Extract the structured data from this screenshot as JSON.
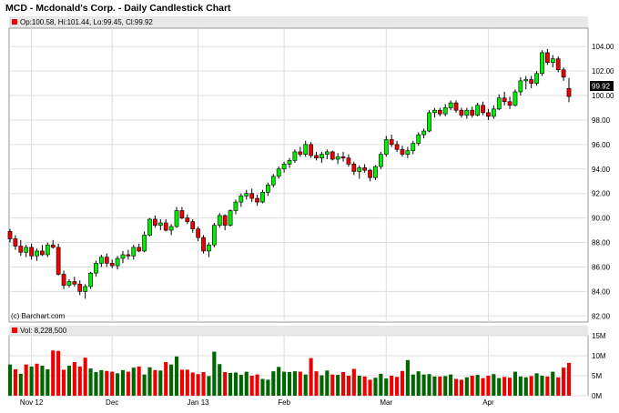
{
  "title": "MCD - Mcdonald's Corp. - Daily Candlestick Chart",
  "info": "Op:100.58, Hi:101.44, Lo:99.45, Cl:99.92",
  "volume_label": "Vol: 8,228,500",
  "copyright": "(c) Barchart.com",
  "colors": {
    "up": "#00ee00",
    "down": "#ee0000",
    "vol_up": "#006600",
    "vol_down": "#ee0000",
    "grid": "#dddddd"
  },
  "chart_data": [
    {
      "type": "candlestick",
      "y_ticks": [
        "104.00",
        "102.00",
        "100.00",
        "98.00",
        "96.00",
        "94.00",
        "92.00",
        "90.00",
        "88.00",
        "86.00",
        "84.00",
        "82.00"
      ],
      "ylim": [
        81.5,
        105.5
      ],
      "last_price_label": "99.92",
      "x_ticks": [
        "Nov 12",
        "Dec",
        "Jan 13",
        "Feb",
        "Mar",
        "Apr"
      ],
      "series": [
        [
          88.9,
          89.1,
          88.0,
          88.3
        ],
        [
          88.3,
          88.6,
          87.4,
          87.7
        ],
        [
          87.7,
          88.2,
          86.9,
          87.2
        ],
        [
          87.2,
          87.8,
          86.8,
          87.6
        ],
        [
          87.6,
          87.9,
          86.6,
          86.9
        ],
        [
          86.9,
          87.5,
          86.5,
          87.3
        ],
        [
          87.3,
          87.8,
          86.9,
          87.0
        ],
        [
          87.0,
          88.0,
          86.8,
          87.8
        ],
        [
          87.8,
          88.2,
          87.5,
          87.6
        ],
        [
          87.6,
          87.9,
          85.3,
          85.4
        ],
        [
          85.4,
          85.7,
          84.2,
          84.5
        ],
        [
          84.5,
          85.0,
          84.3,
          84.8
        ],
        [
          84.8,
          85.2,
          84.4,
          84.6
        ],
        [
          84.6,
          84.9,
          83.7,
          84.0
        ],
        [
          84.0,
          84.6,
          83.4,
          84.4
        ],
        [
          84.4,
          85.6,
          84.2,
          85.5
        ],
        [
          85.5,
          86.5,
          85.2,
          86.3
        ],
        [
          86.3,
          87.0,
          86.0,
          86.8
        ],
        [
          86.8,
          87.1,
          86.0,
          86.3
        ],
        [
          86.3,
          86.6,
          85.9,
          86.1
        ],
        [
          86.1,
          86.9,
          85.8,
          86.7
        ],
        [
          86.7,
          87.3,
          86.3,
          87.0
        ],
        [
          87.0,
          87.4,
          86.6,
          86.9
        ],
        [
          86.9,
          87.8,
          86.6,
          87.6
        ],
        [
          87.6,
          87.9,
          87.2,
          87.3
        ],
        [
          87.3,
          88.9,
          87.2,
          88.6
        ],
        [
          88.6,
          90.0,
          88.5,
          89.9
        ],
        [
          89.9,
          90.2,
          89.2,
          89.4
        ],
        [
          89.4,
          89.9,
          89.0,
          89.6
        ],
        [
          89.6,
          89.9,
          88.9,
          89.0
        ],
        [
          89.0,
          89.5,
          88.6,
          89.3
        ],
        [
          89.3,
          90.9,
          89.2,
          90.6
        ],
        [
          90.6,
          90.9,
          89.9,
          90.0
        ],
        [
          90.0,
          90.3,
          89.5,
          89.7
        ],
        [
          89.7,
          89.9,
          88.8,
          89.1
        ],
        [
          89.1,
          89.3,
          88.1,
          88.4
        ],
        [
          88.4,
          88.6,
          87.1,
          87.3
        ],
        [
          87.3,
          88.0,
          86.8,
          87.8
        ],
        [
          87.8,
          89.6,
          87.6,
          89.4
        ],
        [
          89.4,
          90.4,
          89.2,
          90.2
        ],
        [
          90.2,
          90.3,
          89.0,
          89.4
        ],
        [
          89.4,
          90.7,
          89.3,
          90.6
        ],
        [
          90.6,
          91.5,
          90.3,
          91.3
        ],
        [
          91.3,
          92.0,
          90.9,
          91.8
        ],
        [
          91.8,
          92.3,
          91.5,
          92.0
        ],
        [
          92.0,
          92.4,
          91.3,
          91.6
        ],
        [
          91.6,
          91.9,
          91.0,
          91.3
        ],
        [
          91.3,
          92.3,
          91.2,
          92.1
        ],
        [
          92.1,
          92.9,
          91.8,
          92.7
        ],
        [
          92.7,
          93.6,
          92.5,
          93.4
        ],
        [
          93.4,
          94.2,
          93.2,
          94.0
        ],
        [
          94.0,
          94.6,
          93.7,
          94.4
        ],
        [
          94.4,
          94.9,
          94.1,
          94.7
        ],
        [
          94.7,
          95.6,
          94.5,
          95.4
        ],
        [
          95.4,
          95.8,
          95.0,
          95.2
        ],
        [
          95.2,
          96.3,
          95.0,
          96.0
        ],
        [
          96.0,
          96.2,
          94.9,
          95.1
        ],
        [
          95.1,
          95.4,
          94.7,
          94.9
        ],
        [
          94.9,
          95.4,
          94.5,
          95.2
        ],
        [
          95.2,
          95.6,
          94.8,
          95.4
        ],
        [
          95.4,
          95.5,
          94.7,
          94.8
        ],
        [
          94.8,
          95.3,
          94.4,
          95.0
        ],
        [
          95.0,
          95.4,
          94.6,
          94.9
        ],
        [
          94.9,
          95.2,
          94.2,
          94.4
        ],
        [
          94.4,
          94.6,
          93.5,
          93.8
        ],
        [
          93.8,
          94.3,
          93.2,
          94.1
        ],
        [
          94.1,
          94.4,
          93.7,
          93.9
        ],
        [
          93.9,
          94.0,
          93.0,
          93.3
        ],
        [
          93.3,
          94.3,
          93.1,
          94.2
        ],
        [
          94.2,
          95.4,
          94.0,
          95.2
        ],
        [
          95.2,
          96.7,
          95.0,
          96.4
        ],
        [
          96.4,
          96.8,
          95.8,
          96.0
        ],
        [
          96.0,
          96.3,
          95.4,
          95.6
        ],
        [
          95.6,
          95.9,
          95.0,
          95.2
        ],
        [
          95.2,
          95.8,
          94.9,
          95.5
        ],
        [
          95.5,
          96.3,
          95.2,
          96.1
        ],
        [
          96.1,
          97.0,
          95.9,
          96.8
        ],
        [
          96.8,
          97.3,
          96.5,
          97.1
        ],
        [
          97.1,
          98.8,
          97.0,
          98.6
        ],
        [
          98.6,
          99.0,
          98.2,
          98.8
        ],
        [
          98.8,
          99.0,
          98.3,
          98.5
        ],
        [
          98.5,
          99.3,
          98.3,
          99.0
        ],
        [
          99.0,
          99.6,
          98.8,
          99.4
        ],
        [
          99.4,
          99.6,
          98.6,
          98.8
        ],
        [
          98.8,
          99.0,
          98.2,
          98.4
        ],
        [
          98.4,
          99.0,
          98.1,
          98.8
        ],
        [
          98.8,
          99.1,
          98.2,
          98.4
        ],
        [
          98.4,
          99.4,
          98.3,
          99.2
        ],
        [
          99.2,
          99.5,
          98.4,
          98.6
        ],
        [
          98.6,
          98.9,
          98.0,
          98.3
        ],
        [
          98.3,
          99.2,
          98.1,
          98.9
        ],
        [
          98.9,
          100.1,
          98.8,
          99.8
        ],
        [
          99.8,
          100.3,
          99.2,
          99.5
        ],
        [
          99.5,
          99.9,
          98.9,
          99.2
        ],
        [
          99.2,
          100.5,
          99.1,
          100.3
        ],
        [
          100.3,
          101.5,
          100.0,
          101.2
        ],
        [
          101.2,
          101.6,
          100.5,
          101.3
        ],
        [
          101.3,
          101.6,
          100.6,
          101.0
        ],
        [
          101.0,
          102.0,
          100.8,
          101.8
        ],
        [
          101.8,
          103.7,
          101.6,
          103.5
        ],
        [
          103.5,
          103.8,
          102.5,
          102.7
        ],
        [
          102.7,
          103.3,
          102.3,
          103.0
        ],
        [
          103.0,
          103.2,
          101.9,
          102.1
        ],
        [
          102.1,
          102.3,
          101.2,
          101.5
        ],
        [
          100.58,
          101.44,
          99.45,
          99.92
        ]
      ],
      "volume": {
        "y_ticks": [
          "15M",
          "10M",
          "5M",
          "0M"
        ],
        "ylim": [
          0,
          15
        ],
        "values": [
          7.8,
          6.6,
          5.5,
          7.8,
          7.3,
          8.0,
          7.5,
          6.6,
          11.3,
          11.2,
          6.5,
          7.5,
          8.4,
          7.3,
          9.5,
          6.8,
          5.9,
          6.4,
          6.2,
          6.0,
          5.6,
          6.4,
          6.0,
          7.0,
          7.3,
          5.3,
          7.1,
          6.4,
          6.3,
          8.4,
          7.8,
          9.8,
          6.5,
          6.5,
          5.8,
          5.4,
          5.9,
          4.9,
          11.0,
          7.9,
          5.9,
          5.7,
          5.8,
          5.2,
          6.0,
          5.0,
          5.3,
          4.2,
          4.0,
          6.1,
          7.2,
          6.0,
          5.9,
          6.1,
          6.0,
          5.3,
          9.4,
          6.1,
          5.1,
          6.3,
          5.3,
          5.2,
          5.9,
          5.0,
          6.7,
          5.0,
          4.8,
          4.0,
          4.5,
          5.5,
          4.3,
          5.0,
          4.7,
          6.2,
          8.9,
          5.3,
          6.1,
          5.3,
          5.4,
          4.8,
          4.8,
          4.9,
          5.3,
          4.2,
          4.0,
          4.6,
          5.0,
          5.2,
          4.4,
          5.0,
          5.4,
          4.4,
          4.7,
          4.5,
          6.0,
          4.8,
          4.6,
          4.9,
          5.6,
          5.0,
          4.8,
          6.0,
          4.6,
          7.0,
          8.2
        ],
        "up": [
          true,
          false,
          true,
          false,
          true,
          false,
          true,
          true,
          false,
          false,
          false,
          true,
          false,
          false,
          false,
          true,
          true,
          true,
          false,
          false,
          true,
          true,
          false,
          true,
          false,
          true,
          true,
          false,
          true,
          false,
          true,
          true,
          false,
          false,
          false,
          false,
          false,
          true,
          true,
          true,
          false,
          true,
          true,
          true,
          true,
          false,
          false,
          true,
          true,
          true,
          true,
          true,
          true,
          true,
          false,
          true,
          false,
          false,
          true,
          true,
          false,
          true,
          false,
          false,
          false,
          true,
          false,
          false,
          true,
          true,
          true,
          false,
          false,
          false,
          true,
          true,
          true,
          true,
          true,
          true,
          false,
          true,
          true,
          false,
          false,
          true,
          false,
          true,
          false,
          false,
          true,
          true,
          false,
          false,
          true,
          true,
          true,
          false,
          true,
          true,
          false,
          true,
          false,
          false,
          false
        ]
      }
    }
  ]
}
